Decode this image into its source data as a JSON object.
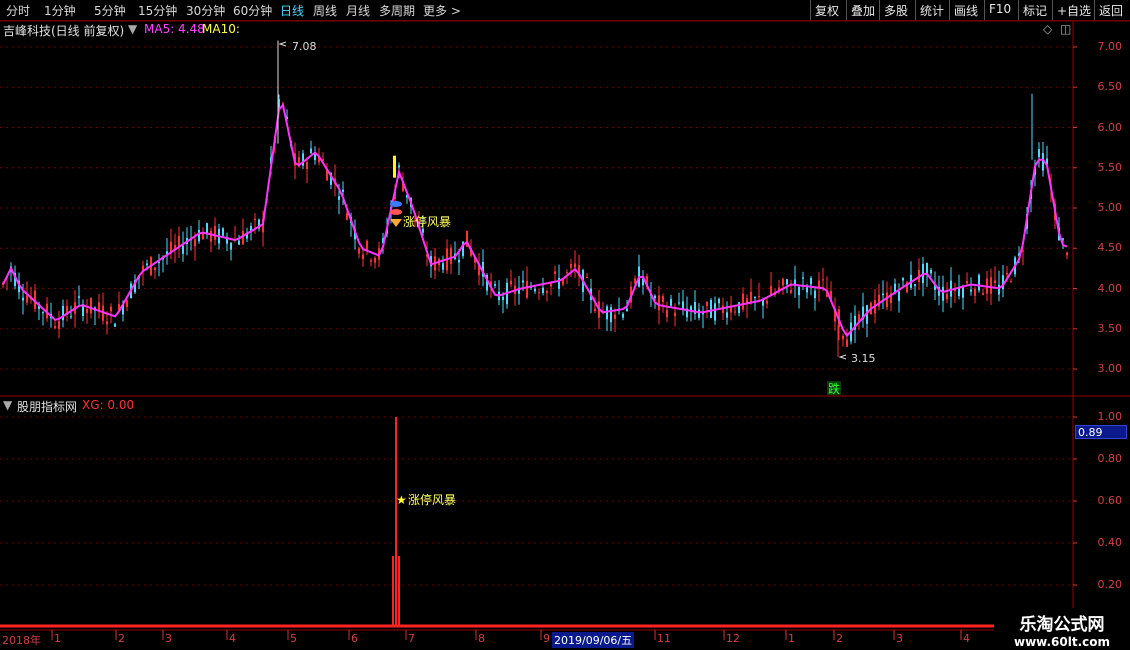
{
  "toolbar": {
    "periods": [
      "分时",
      "1分钟",
      "5分钟",
      "15分钟",
      "30分钟",
      "60分钟",
      "日线",
      "周线",
      "月线",
      "多周期",
      "更多 >"
    ],
    "active_period": "日线",
    "right_buttons": [
      "复权",
      "叠加",
      "多股",
      "统计",
      "画线",
      "F10",
      "标记",
      "+自选",
      "返回"
    ]
  },
  "main_panel": {
    "title": "吉峰科技(日线 前复权)",
    "ma5_label": "MA5: 4.48",
    "ma10_label": "MA10:",
    "y_ticks": [
      "7.00",
      "6.50",
      "6.00",
      "5.50",
      "5.00",
      "4.50",
      "4.00",
      "3.50",
      "3.00"
    ],
    "high_label": "7.08",
    "low_label": "3.15",
    "signal_label": "涨停风暴",
    "marker_text": "跌",
    "colors": {
      "ma_line": "#ff33ff",
      "up": "#ff3333",
      "down": "#4fd8ff",
      "grid": "#6a0000"
    }
  },
  "indicator_panel": {
    "title": "股朋指标网",
    "value_label": "XG: 0.00",
    "signal_label": "涨停风暴",
    "y_ticks": [
      "1.00",
      "0.80",
      "0.60",
      "0.40",
      "0.20"
    ],
    "current_value": "0.89"
  },
  "date_axis": {
    "labels": [
      "2018年",
      "1",
      "2",
      "3",
      "4",
      "5",
      "6",
      "7",
      "8",
      "9",
      "2019/09/06/五",
      "11",
      "12",
      "1",
      "2",
      "3",
      "4"
    ]
  },
  "watermark": {
    "line1": "乐淘公式网",
    "line2": "www.60lt.com"
  }
}
